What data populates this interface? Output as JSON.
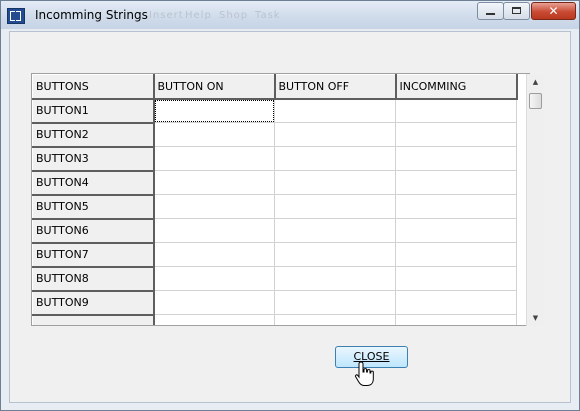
{
  "window": {
    "title": "Incomming Strings",
    "ghost_menu": [
      "Insert",
      "Help",
      "Shop",
      "Task"
    ]
  },
  "grid": {
    "columns": [
      "BUTTONS",
      "BUTTON ON",
      "BUTTON OFF",
      "INCOMMING"
    ],
    "rows": [
      {
        "label": "BUTTON1",
        "on": "",
        "off": "",
        "incoming": ""
      },
      {
        "label": "BUTTON2",
        "on": "",
        "off": "",
        "incoming": ""
      },
      {
        "label": "BUTTON3",
        "on": "",
        "off": "",
        "incoming": ""
      },
      {
        "label": "BUTTON4",
        "on": "",
        "off": "",
        "incoming": ""
      },
      {
        "label": "BUTTON5",
        "on": "",
        "off": "",
        "incoming": ""
      },
      {
        "label": "BUTTON6",
        "on": "",
        "off": "",
        "incoming": ""
      },
      {
        "label": "BUTTON7",
        "on": "",
        "off": "",
        "incoming": ""
      },
      {
        "label": "BUTTON8",
        "on": "",
        "off": "",
        "incoming": ""
      },
      {
        "label": "BUTTON9",
        "on": "",
        "off": "",
        "incoming": ""
      },
      {
        "label": "",
        "on": "",
        "off": "",
        "incoming": ""
      }
    ]
  },
  "buttons": {
    "close": "CLOSE"
  },
  "icons": {
    "app": "app-icon",
    "minimize": "minimize-icon",
    "maximize": "maximize-icon",
    "close": "close-icon",
    "cursor": "hand-cursor-icon"
  },
  "colors": {
    "close_window": "#c94a34",
    "button_border": "#3c7fb1"
  }
}
